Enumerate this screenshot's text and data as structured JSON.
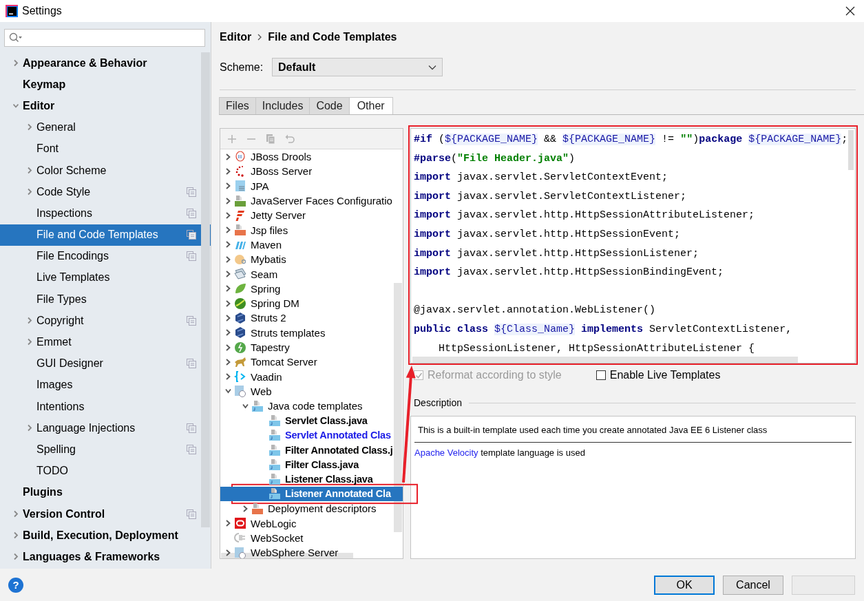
{
  "window": {
    "title": "Settings"
  },
  "sidebar": {
    "items": [
      {
        "label": "Appearance & Behavior",
        "expanded": false,
        "project": false,
        "selected": false
      },
      {
        "label": "Keymap",
        "project": false,
        "selected": false
      },
      {
        "label": "Editor",
        "expanded": true,
        "project": false,
        "selected": false,
        "children": [
          {
            "label": "General",
            "expanded": false,
            "project": false,
            "selected": false
          },
          {
            "label": "Font",
            "project": false,
            "selected": false
          },
          {
            "label": "Color Scheme",
            "expanded": false,
            "project": false,
            "selected": false
          },
          {
            "label": "Code Style",
            "expanded": false,
            "project": true,
            "selected": false
          },
          {
            "label": "Inspections",
            "project": true,
            "selected": false
          },
          {
            "label": "File and Code Templates",
            "project": true,
            "selected": true
          },
          {
            "label": "File Encodings",
            "project": true,
            "selected": false
          },
          {
            "label": "Live Templates",
            "project": false,
            "selected": false
          },
          {
            "label": "File Types",
            "project": false,
            "selected": false
          },
          {
            "label": "Copyright",
            "expanded": false,
            "project": true,
            "selected": false
          },
          {
            "label": "Emmet",
            "expanded": false,
            "project": false,
            "selected": false
          },
          {
            "label": "GUI Designer",
            "project": true,
            "selected": false
          },
          {
            "label": "Images",
            "project": false,
            "selected": false
          },
          {
            "label": "Intentions",
            "project": false,
            "selected": false
          },
          {
            "label": "Language Injections",
            "expanded": false,
            "project": true,
            "selected": false
          },
          {
            "label": "Spelling",
            "project": true,
            "selected": false
          },
          {
            "label": "TODO",
            "project": false,
            "selected": false
          }
        ]
      },
      {
        "label": "Plugins",
        "project": false,
        "selected": false
      },
      {
        "label": "Version Control",
        "expanded": false,
        "project": true,
        "selected": false
      },
      {
        "label": "Build, Execution, Deployment",
        "expanded": false,
        "project": false,
        "selected": false
      },
      {
        "label": "Languages & Frameworks",
        "expanded": false,
        "project": false,
        "selected": false
      }
    ]
  },
  "breadcrumb": {
    "parent": "Editor",
    "current": "File and Code Templates"
  },
  "scheme": {
    "label": "Scheme:",
    "value": "Default"
  },
  "tabs": [
    {
      "label": "Files",
      "selected": false
    },
    {
      "label": "Includes",
      "selected": false
    },
    {
      "label": "Code",
      "selected": false
    },
    {
      "label": "Other",
      "selected": true
    }
  ],
  "tree": {
    "toolbar": {
      "disabled": true
    },
    "items": [
      {
        "label": "JBoss Drools",
        "expanded": false
      },
      {
        "label": "JBoss Server",
        "expanded": false
      },
      {
        "label": "JPA",
        "expanded": false
      },
      {
        "label": "JavaServer Faces Configuratio",
        "expanded": false
      },
      {
        "label": "Jetty Server",
        "expanded": false
      },
      {
        "label": "Jsp files",
        "expanded": false
      },
      {
        "label": "Maven",
        "expanded": false
      },
      {
        "label": "Mybatis",
        "expanded": false
      },
      {
        "label": "Seam",
        "expanded": false
      },
      {
        "label": "Spring",
        "expanded": false
      },
      {
        "label": "Spring DM",
        "expanded": false
      },
      {
        "label": "Struts 2",
        "expanded": false
      },
      {
        "label": "Struts templates",
        "expanded": false
      },
      {
        "label": "Tapestry",
        "expanded": false
      },
      {
        "label": "Tomcat Server",
        "expanded": false
      },
      {
        "label": "Vaadin",
        "expanded": false
      },
      {
        "label": "Web",
        "expanded": true,
        "children": [
          {
            "label": "Java code templates",
            "expanded": true,
            "children": [
              {
                "label": "Servlet Class.java",
                "modified": false,
                "selected": false
              },
              {
                "label": "Servlet Annotated Clas",
                "modified": true,
                "selected": false
              },
              {
                "label": "Filter Annotated Class.j",
                "modified": false,
                "selected": false
              },
              {
                "label": "Filter Class.java",
                "modified": false,
                "selected": false
              },
              {
                "label": "Listener Class.java",
                "modified": false,
                "selected": false
              },
              {
                "label": "Listener Annotated Cla",
                "modified": false,
                "selected": true
              }
            ]
          },
          {
            "label": "Deployment descriptors",
            "expanded": false
          }
        ]
      },
      {
        "label": "WebLogic",
        "expanded": false
      },
      {
        "label": "WebSocket"
      },
      {
        "label": "WebSphere Server",
        "expanded": false
      }
    ]
  },
  "editor": {
    "lines": [
      {
        "kind": "code",
        "parts": [
          {
            "kind": "kw",
            "text": "#if"
          },
          {
            "kind": "plain",
            "text": " ("
          },
          {
            "kind": "var",
            "text": "${PACKAGE_NAME}"
          },
          {
            "kind": "plain",
            "text": " && "
          },
          {
            "kind": "var",
            "text": "${PACKAGE_NAME}"
          },
          {
            "kind": "plain",
            "text": " != "
          },
          {
            "kind": "str",
            "text": "\"\""
          },
          {
            "kind": "plain",
            "text": ")"
          },
          {
            "kind": "kw",
            "text": "package "
          },
          {
            "kind": "var",
            "text": "${PACKAGE_NAME}"
          },
          {
            "kind": "plain",
            "text": ";"
          }
        ]
      },
      {
        "kind": "code",
        "parts": [
          {
            "kind": "kw",
            "text": "#parse"
          },
          {
            "kind": "plain",
            "text": "("
          },
          {
            "kind": "str",
            "text": "\"File Header.java\""
          },
          {
            "kind": "plain",
            "text": ")"
          }
        ]
      },
      {
        "kind": "code",
        "parts": [
          {
            "kind": "kw",
            "text": "import"
          },
          {
            "kind": "plain",
            "text": " javax.servlet.ServletContextEvent;"
          }
        ]
      },
      {
        "kind": "code",
        "parts": [
          {
            "kind": "kw",
            "text": "import"
          },
          {
            "kind": "plain",
            "text": " javax.servlet.ServletContextListener;"
          }
        ]
      },
      {
        "kind": "code",
        "parts": [
          {
            "kind": "kw",
            "text": "import"
          },
          {
            "kind": "plain",
            "text": " javax.servlet.http.HttpSessionAttributeListener;"
          }
        ]
      },
      {
        "kind": "code",
        "parts": [
          {
            "kind": "kw",
            "text": "import"
          },
          {
            "kind": "plain",
            "text": " javax.servlet.http.HttpSessionEvent;"
          }
        ]
      },
      {
        "kind": "code",
        "parts": [
          {
            "kind": "kw",
            "text": "import"
          },
          {
            "kind": "plain",
            "text": " javax.servlet.http.HttpSessionListener;"
          }
        ]
      },
      {
        "kind": "code",
        "parts": [
          {
            "kind": "kw",
            "text": "import"
          },
          {
            "kind": "plain",
            "text": " javax.servlet.http.HttpSessionBindingEvent;"
          }
        ]
      },
      {
        "kind": "blank"
      },
      {
        "kind": "code",
        "parts": [
          {
            "kind": "plain",
            "text": "@javax.servlet.annotation.WebListener()"
          }
        ]
      },
      {
        "kind": "code",
        "parts": [
          {
            "kind": "kw",
            "text": "public class "
          },
          {
            "kind": "var",
            "text": "${Class_Name}"
          },
          {
            "kind": "kw",
            "text": " implements"
          },
          {
            "kind": "plain",
            "text": " ServletContextListener,"
          }
        ]
      },
      {
        "kind": "code",
        "parts": [
          {
            "kind": "plain",
            "text": "    HttpSessionListener, HttpSessionAttributeListener {"
          }
        ]
      }
    ]
  },
  "options": [
    {
      "label": "Reformat according to style",
      "checked": true,
      "disabled": true
    },
    {
      "label": "Enable Live Templates",
      "checked": false,
      "disabled": false
    }
  ],
  "description": {
    "title": "Description",
    "text": "This is a built-in template used each time you create annotated Java EE 6 Listener class",
    "link": "Apache Velocity",
    "rest": " template language is used"
  },
  "footer": {
    "help": "?",
    "buttons": [
      {
        "label": "OK",
        "focused": true,
        "disabled": false
      },
      {
        "label": "Cancel",
        "focused": false,
        "disabled": false
      },
      {
        "focused": false,
        "disabled": true
      }
    ]
  }
}
